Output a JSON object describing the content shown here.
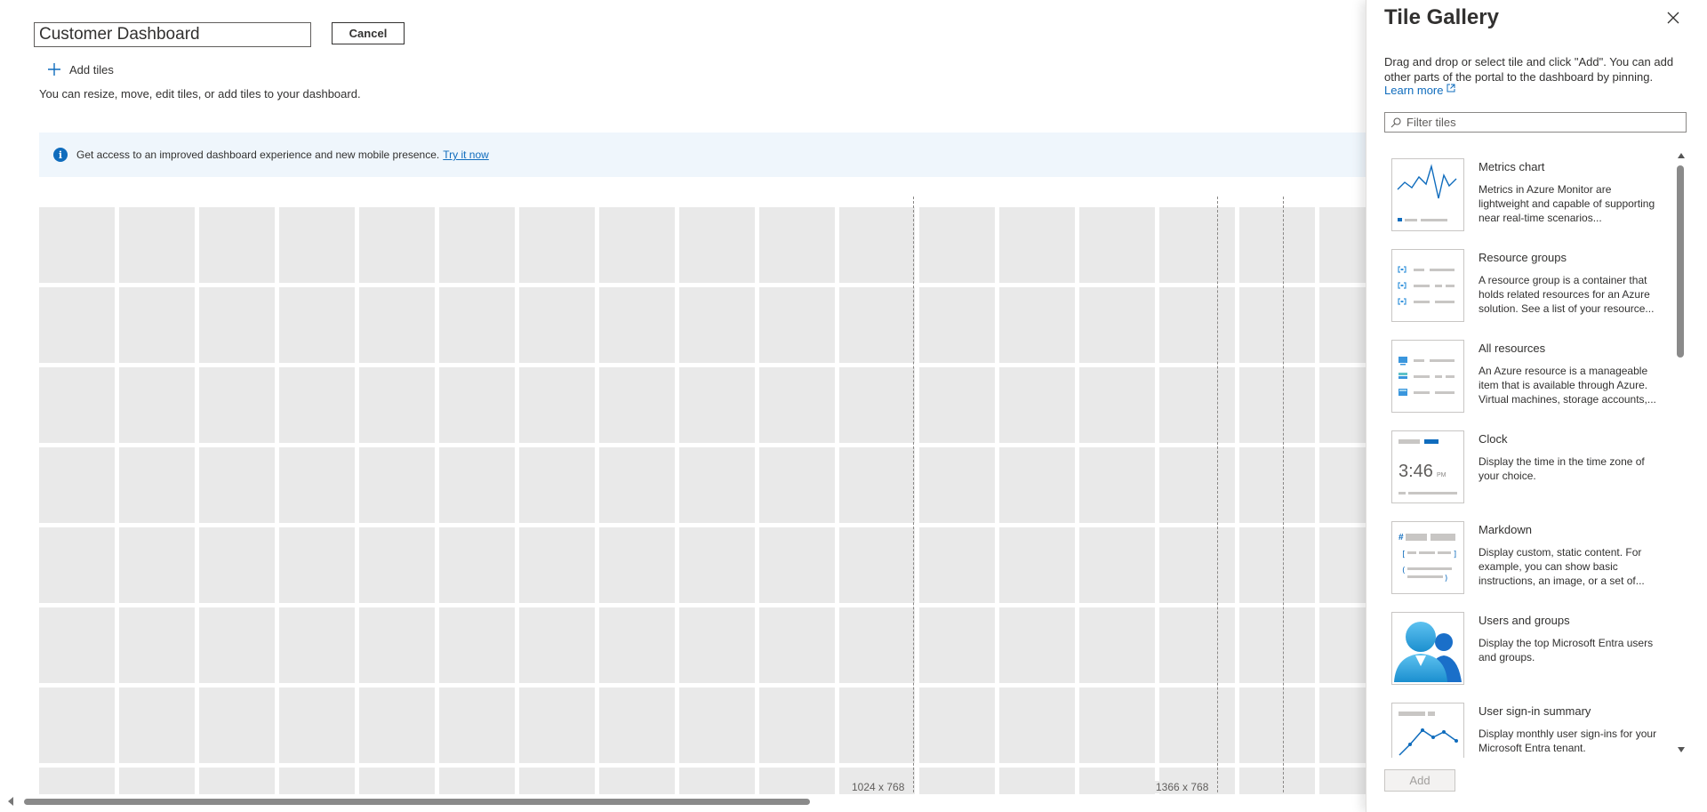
{
  "editor": {
    "dashboard_title": "Customer Dashboard",
    "cancel_label": "Cancel",
    "add_tiles_label": "Add tiles",
    "hint": "You can resize, move, edit tiles, or add tiles to your dashboard."
  },
  "banner": {
    "text": "Get access to an improved dashboard experience and new mobile presence.",
    "link": "Try it now"
  },
  "grid": {
    "guides": [
      {
        "label": "1024 x 768"
      },
      {
        "label": "1366 x 768"
      },
      {
        "label": ""
      }
    ]
  },
  "panel": {
    "title": "Tile Gallery",
    "description": "Drag and drop or select tile and click \"Add\". You can add other parts of the portal to the dashboard by pinning.",
    "learn_more": "Learn more",
    "filter_placeholder": "Filter tiles",
    "add_label": "Add",
    "tiles": [
      {
        "name": "Metrics chart",
        "desc": "Metrics in Azure Monitor are lightweight and capable of supporting near real-time scenarios...",
        "icon": "metrics-chart"
      },
      {
        "name": "Resource groups",
        "desc": "A resource group is a container that holds related resources for an Azure solution. See a list of your resource...",
        "icon": "resource-groups"
      },
      {
        "name": "All resources",
        "desc": "An Azure resource is a manageable item that is available through Azure. Virtual machines, storage accounts,...",
        "icon": "all-resources"
      },
      {
        "name": "Clock",
        "desc": "Display the time in the time zone of your choice.",
        "icon": "clock",
        "time": "3:46",
        "ampm": "PM"
      },
      {
        "name": "Markdown",
        "desc": "Display custom, static content. For example, you can show basic instructions, an image, or a set of...",
        "icon": "markdown"
      },
      {
        "name": "Users and groups",
        "desc": "Display the top Microsoft Entra users and groups.",
        "icon": "users-groups"
      },
      {
        "name": "User sign-in summary",
        "desc": "Display monthly user sign-ins for your Microsoft Entra tenant.",
        "icon": "sign-in-summary"
      }
    ]
  },
  "colors": {
    "accent": "#0f6cbd",
    "tile_bg": "#e9e9e9",
    "banner_bg": "#eff6fc"
  }
}
